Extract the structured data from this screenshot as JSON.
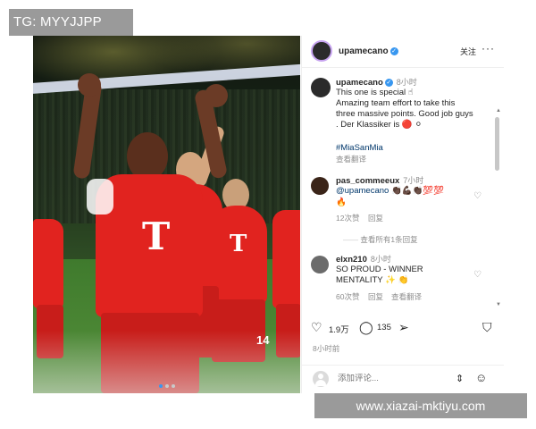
{
  "overlay": {
    "tg_label": "TG: MYYJJPP",
    "watermark": "www.xiazai-mktiyu.com"
  },
  "photo": {
    "player_logo": "T",
    "player_number": "14",
    "active_slide": 1,
    "slide_count": 3
  },
  "header": {
    "username": "upamecano",
    "follow_label": "关注",
    "more_label": "···",
    "verified_icon": "check-icon"
  },
  "caption": {
    "username": "upamecano",
    "time": "8小时",
    "lines": [
      "This one is special ☝",
      "Amazing team effort to take this",
      "three massive points. Good job guys",
      ". Der Klassiker is 🔴 ⚪"
    ],
    "hashtag": "#MiaSanMia",
    "translate": "查看翻译"
  },
  "comments": [
    {
      "username": "pas_commeeux",
      "time": "7小时",
      "mention": "@upamecano",
      "emojis": "👏🏿💪🏿👏🏿💯💯",
      "emoji_line2": "🔥",
      "likes": "12次赞",
      "reply": "回复"
    },
    {
      "username": "elxn210",
      "time": "8小时",
      "text_line1": "SO PROUD - WINNER",
      "text_line2": "MENTALITY ✨ 👏",
      "likes": "60次赞",
      "reply": "回复",
      "translate": "查看翻译"
    }
  ],
  "view_replies": "查看所有1条回复",
  "actions": {
    "likes": "1.9万",
    "comments": "135"
  },
  "post_time": "8小时前",
  "comment_input": {
    "placeholder": "添加评论..."
  },
  "colors": {
    "accent": "#3897f0",
    "kit_red": "#e1231f",
    "hashtag": "#00376b"
  }
}
